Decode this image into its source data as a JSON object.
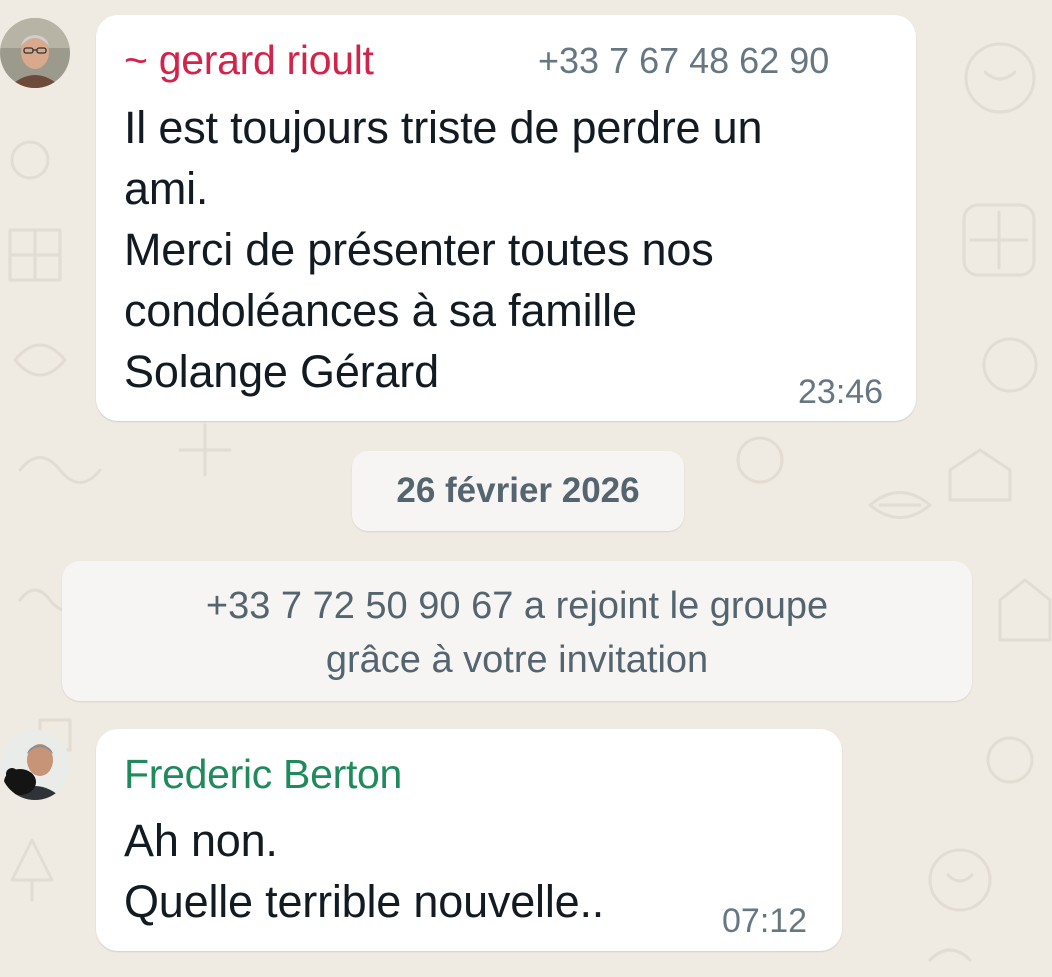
{
  "colors": {
    "chat_background": "#efeae2",
    "bubble_background": "#ffffff",
    "sender_gerard": "#d4234a",
    "sender_frederic": "#1f8a5b",
    "meta_text": "#667781",
    "system_text": "#54656f"
  },
  "messages": [
    {
      "sender": "~ gerard rioult",
      "phone": "+33 7 67 48 62 90",
      "lines": [
        "Il est toujours triste de perdre un",
        "ami.",
        "Merci de présenter toutes nos",
        "condoléances à sa famille",
        "Solange Gérard"
      ],
      "time": "23:46",
      "avatar_icon": "user-photo-gerard"
    },
    {
      "sender": "Frederic Berton",
      "lines": [
        "Ah non.",
        "Quelle terrible nouvelle.."
      ],
      "time": "07:12",
      "avatar_icon": "user-photo-frederic"
    }
  ],
  "date_separator": "26 février 2026",
  "system_message": {
    "lines": [
      "+33 7 72 50 90 67 a rejoint le groupe",
      "grâce à votre invitation"
    ]
  }
}
